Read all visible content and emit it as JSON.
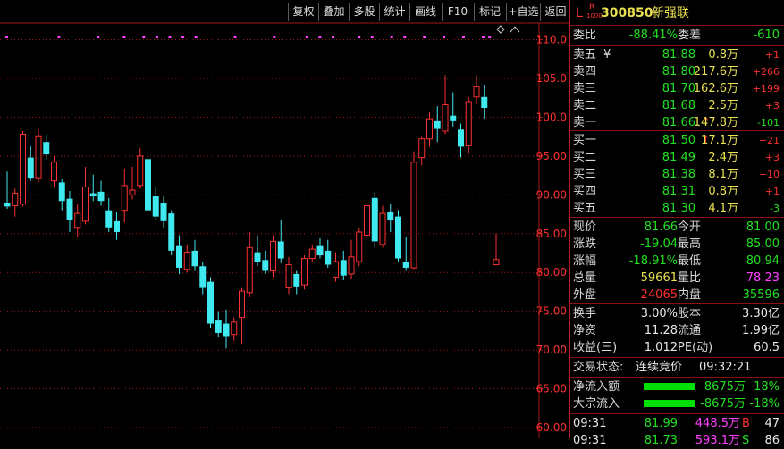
{
  "toolbar": {
    "buttons": [
      "复权",
      "叠加",
      "多股",
      "统计",
      "画线",
      "F10",
      "标记",
      "+自选",
      "返回"
    ]
  },
  "stock": {
    "l_mark": "L",
    "r_mark": "R",
    "r_sub": "1000",
    "code": "300850",
    "name": "新强联"
  },
  "order_ratio": {
    "label1": "委比",
    "value1": "-88.41%",
    "label2": "委差",
    "value2": "-610"
  },
  "asks": [
    {
      "label": "卖五",
      "mark": "¥",
      "arrow": "",
      "price": "81.88",
      "vol": "0.8万",
      "chg": "+1"
    },
    {
      "label": "卖四",
      "mark": "",
      "arrow": "",
      "price": "81.80",
      "vol": "217.6万",
      "chg": "+266"
    },
    {
      "label": "卖三",
      "mark": "",
      "arrow": "",
      "price": "81.70",
      "vol": "162.6万",
      "chg": "+199"
    },
    {
      "label": "卖二",
      "mark": "",
      "arrow": "",
      "price": "81.68",
      "vol": "2.5万",
      "chg": "+3"
    },
    {
      "label": "卖一",
      "mark": "",
      "arrow": "↑",
      "price": "81.66",
      "vol": "147.8万",
      "chg": "-101"
    }
  ],
  "bids": [
    {
      "label": "买一",
      "arrow": "↑",
      "price": "81.50",
      "vol": "17.1万",
      "chg": "+21"
    },
    {
      "label": "买二",
      "arrow": "",
      "price": "81.49",
      "vol": "2.4万",
      "chg": "+3"
    },
    {
      "label": "买三",
      "arrow": "",
      "price": "81.38",
      "vol": "8.1万",
      "chg": "+10"
    },
    {
      "label": "买四",
      "arrow": "",
      "price": "81.31",
      "vol": "0.8万",
      "chg": "+1"
    },
    {
      "label": "买五",
      "arrow": "",
      "price": "81.30",
      "vol": "4.1万",
      "chg": "-3"
    }
  ],
  "quote": [
    {
      "l1": "现价",
      "v1": "81.66",
      "c1": "green",
      "l2": "今开",
      "v2": "81.00",
      "c2": "green"
    },
    {
      "l1": "涨跌",
      "v1": "-19.04",
      "c1": "green",
      "l2": "最高",
      "v2": "85.00",
      "c2": "green"
    },
    {
      "l1": "涨幅",
      "v1": "-18.91%",
      "c1": "green",
      "l2": "最低",
      "v2": "80.94",
      "c2": "green"
    },
    {
      "l1": "总量",
      "v1": "59661",
      "c1": "yellow",
      "l2": "量比",
      "v2": "78.23",
      "c2": "magenta"
    },
    {
      "l1": "外盘",
      "v1": "24065",
      "c1": "red",
      "l2": "内盘",
      "v2": "35596",
      "c2": "green"
    }
  ],
  "fundamentals": [
    {
      "l1": "换手",
      "v1": "3.00%",
      "l2": "股本",
      "v2": "3.30亿"
    },
    {
      "l1": "净资",
      "v1": "11.28",
      "l2": "流通",
      "v2": "1.99亿"
    },
    {
      "l1": "收益(三)",
      "v1": "1.012",
      "l2": "PE(动)",
      "v2": "60.5"
    }
  ],
  "trade_status": {
    "label": "交易状态:",
    "value": "连续竞价",
    "time": "09:32:21"
  },
  "flows": [
    {
      "label": "净流入额",
      "value": "-8675万",
      "pct": "-18%"
    },
    {
      "label": "大宗流入",
      "value": "-8675万",
      "pct": "-18%"
    }
  ],
  "ticks": [
    {
      "time": "09:31",
      "price": "81.99",
      "vol": "448.5万",
      "side": "B",
      "count": "47"
    },
    {
      "time": "09:31",
      "price": "81.73",
      "vol": "593.1万",
      "side": "S",
      "count": "86"
    }
  ],
  "colors": {
    "up": "#ff3030",
    "down": "#40e8f0",
    "grid": "#a01818",
    "axis_text": "#ff3030",
    "dots": "#ff40ff",
    "bar_green": "#00e000"
  },
  "chart_data": {
    "type": "candlestick",
    "ylim": [
      60,
      112
    ],
    "y_ticks": [
      60,
      65,
      70,
      75,
      80,
      85,
      90,
      95,
      100,
      105,
      110
    ],
    "y_tick_labels": [
      "60.00",
      "65.00",
      "70.00",
      "75.00",
      "80.00",
      "85.00",
      "90.00",
      "95.00",
      "100.0",
      "105.0",
      "110.0"
    ],
    "candles": [
      {
        "o": 89.0,
        "h": 93.0,
        "l": 88.2,
        "c": 88.5
      },
      {
        "o": 88.6,
        "h": 90.8,
        "l": 87.2,
        "c": 90.2
      },
      {
        "o": 88.8,
        "h": 98.2,
        "l": 88.5,
        "c": 97.8
      },
      {
        "o": 94.8,
        "h": 96.4,
        "l": 91.8,
        "c": 92.2
      },
      {
        "o": 92.2,
        "h": 98.6,
        "l": 91.6,
        "c": 97.6
      },
      {
        "o": 96.8,
        "h": 97.8,
        "l": 94.5,
        "c": 95.2
      },
      {
        "o": 91.8,
        "h": 95.0,
        "l": 91.0,
        "c": 94.2
      },
      {
        "o": 91.6,
        "h": 92.0,
        "l": 88.0,
        "c": 89.2
      },
      {
        "o": 89.5,
        "h": 90.5,
        "l": 85.2,
        "c": 86.8
      },
      {
        "o": 85.8,
        "h": 88.8,
        "l": 84.5,
        "c": 87.6
      },
      {
        "o": 86.6,
        "h": 93.6,
        "l": 86.2,
        "c": 91.0
      },
      {
        "o": 90.2,
        "h": 92.6,
        "l": 89.2,
        "c": 89.8
      },
      {
        "o": 90.4,
        "h": 91.8,
        "l": 88.6,
        "c": 89.2
      },
      {
        "o": 88.0,
        "h": 89.6,
        "l": 85.2,
        "c": 85.8
      },
      {
        "o": 86.6,
        "h": 87.8,
        "l": 84.2,
        "c": 85.2
      },
      {
        "o": 88.0,
        "h": 93.4,
        "l": 86.4,
        "c": 91.2
      },
      {
        "o": 90.0,
        "h": 93.6,
        "l": 89.4,
        "c": 90.6
      },
      {
        "o": 91.2,
        "h": 96.0,
        "l": 90.8,
        "c": 95.0
      },
      {
        "o": 94.6,
        "h": 95.4,
        "l": 87.5,
        "c": 88.0
      },
      {
        "o": 89.8,
        "h": 91.0,
        "l": 86.8,
        "c": 87.2
      },
      {
        "o": 89.0,
        "h": 89.8,
        "l": 85.8,
        "c": 86.6
      },
      {
        "o": 87.6,
        "h": 88.0,
        "l": 82.2,
        "c": 82.8
      },
      {
        "o": 83.4,
        "h": 84.8,
        "l": 79.8,
        "c": 80.6
      },
      {
        "o": 80.4,
        "h": 83.6,
        "l": 80.0,
        "c": 82.6
      },
      {
        "o": 82.8,
        "h": 84.2,
        "l": 80.2,
        "c": 80.8
      },
      {
        "o": 80.8,
        "h": 81.4,
        "l": 77.2,
        "c": 78.0
      },
      {
        "o": 78.8,
        "h": 79.4,
        "l": 72.8,
        "c": 73.4
      },
      {
        "o": 73.8,
        "h": 75.0,
        "l": 71.6,
        "c": 72.2
      },
      {
        "o": 73.4,
        "h": 75.2,
        "l": 70.2,
        "c": 71.8
      },
      {
        "o": 72.0,
        "h": 74.2,
        "l": 71.2,
        "c": 73.6
      },
      {
        "o": 74.2,
        "h": 78.0,
        "l": 70.8,
        "c": 77.6
      },
      {
        "o": 77.4,
        "h": 85.2,
        "l": 76.8,
        "c": 83.2
      },
      {
        "o": 82.6,
        "h": 84.8,
        "l": 80.8,
        "c": 81.4
      },
      {
        "o": 81.6,
        "h": 82.8,
        "l": 79.8,
        "c": 80.2
      },
      {
        "o": 80.2,
        "h": 84.8,
        "l": 79.4,
        "c": 84.0
      },
      {
        "o": 84.0,
        "h": 86.8,
        "l": 81.2,
        "c": 81.8
      },
      {
        "o": 78.0,
        "h": 82.0,
        "l": 77.2,
        "c": 81.0
      },
      {
        "o": 79.8,
        "h": 80.2,
        "l": 77.2,
        "c": 78.2
      },
      {
        "o": 78.4,
        "h": 82.2,
        "l": 77.8,
        "c": 81.8
      },
      {
        "o": 81.8,
        "h": 83.6,
        "l": 81.4,
        "c": 83.0
      },
      {
        "o": 83.4,
        "h": 84.4,
        "l": 81.8,
        "c": 82.2
      },
      {
        "o": 82.8,
        "h": 84.2,
        "l": 80.6,
        "c": 81.0
      },
      {
        "o": 79.4,
        "h": 82.6,
        "l": 78.8,
        "c": 81.4
      },
      {
        "o": 81.6,
        "h": 82.8,
        "l": 79.0,
        "c": 79.6
      },
      {
        "o": 79.8,
        "h": 84.2,
        "l": 79.2,
        "c": 82.0
      },
      {
        "o": 81.4,
        "h": 85.8,
        "l": 80.8,
        "c": 85.2
      },
      {
        "o": 84.8,
        "h": 89.4,
        "l": 84.2,
        "c": 88.6
      },
      {
        "o": 89.6,
        "h": 90.4,
        "l": 83.2,
        "c": 84.0
      },
      {
        "o": 83.6,
        "h": 88.6,
        "l": 83.2,
        "c": 87.6
      },
      {
        "o": 87.8,
        "h": 88.8,
        "l": 85.2,
        "c": 86.8
      },
      {
        "o": 87.2,
        "h": 88.0,
        "l": 81.4,
        "c": 81.8
      },
      {
        "o": 81.4,
        "h": 84.6,
        "l": 80.2,
        "c": 80.6
      },
      {
        "o": 80.6,
        "h": 95.6,
        "l": 80.4,
        "c": 94.2
      },
      {
        "o": 94.8,
        "h": 97.6,
        "l": 93.8,
        "c": 97.2
      },
      {
        "o": 97.2,
        "h": 100.6,
        "l": 96.2,
        "c": 99.8
      },
      {
        "o": 99.6,
        "h": 101.4,
        "l": 96.8,
        "c": 98.6
      },
      {
        "o": 98.2,
        "h": 105.4,
        "l": 97.8,
        "c": 101.6
      },
      {
        "o": 100.2,
        "h": 103.2,
        "l": 98.8,
        "c": 99.6
      },
      {
        "o": 98.4,
        "h": 99.2,
        "l": 94.8,
        "c": 96.2
      },
      {
        "o": 96.4,
        "h": 102.6,
        "l": 95.4,
        "c": 102.0
      },
      {
        "o": 102.6,
        "h": 105.4,
        "l": 101.6,
        "c": 104.0
      },
      {
        "o": 102.6,
        "h": 104.2,
        "l": 99.8,
        "c": 101.2
      },
      {
        "o": 81.0,
        "h": 85.0,
        "l": 80.94,
        "c": 81.66
      }
    ],
    "marker_dots_at_candles": [
      0,
      8,
      14,
      18,
      21,
      23,
      25,
      27,
      29,
      35,
      41,
      46,
      48,
      50,
      54,
      56,
      59,
      61,
      64,
      67,
      70,
      73,
      74
    ]
  }
}
